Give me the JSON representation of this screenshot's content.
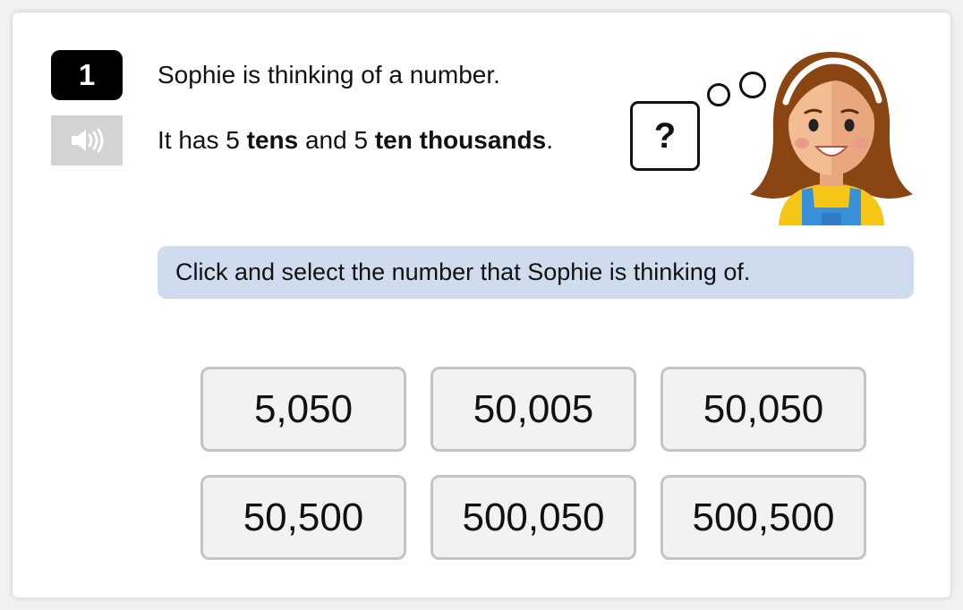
{
  "question": {
    "number": "1",
    "line1": "Sophie is thinking of a number.",
    "line2_prefix": "It has 5 ",
    "line2_bold1": "tens",
    "line2_middle": " and 5 ",
    "line2_bold2": "ten thousands",
    "line2_suffix": "."
  },
  "thought": {
    "symbol": "?"
  },
  "icons": {
    "audio": "speaker-icon",
    "character": "sophie-avatar"
  },
  "instruction": "Click and select the number that Sophie is thinking of.",
  "options": [
    "5,050",
    "50,005",
    "50,050",
    "50,500",
    "500,050",
    "500,500"
  ],
  "colors": {
    "number_badge": "#000000",
    "audio_button": "#d3d3d3",
    "instruction_bg": "#cfdcee",
    "option_bg": "#f2f2f2",
    "option_border": "#c4c4c4"
  }
}
